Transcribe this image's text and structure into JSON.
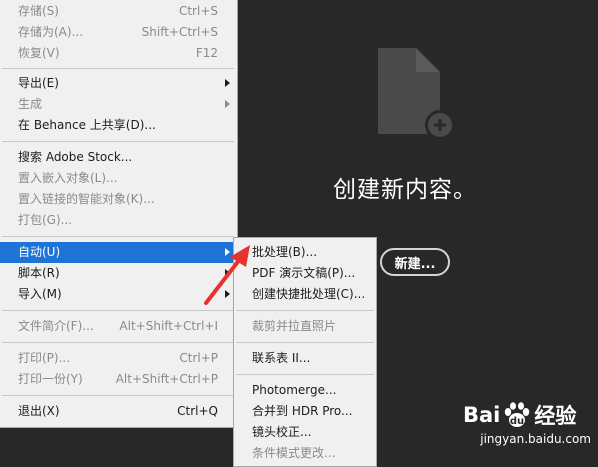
{
  "start_panel": {
    "title": "创建新内容。",
    "new_button": "新建..."
  },
  "file_menu": {
    "items": [
      {
        "label": "存储(S)",
        "shortcut": "Ctrl+S",
        "disabled": true
      },
      {
        "label": "存储为(A)...",
        "shortcut": "Shift+Ctrl+S",
        "disabled": true
      },
      {
        "label": "恢复(V)",
        "shortcut": "F12",
        "disabled": true
      },
      {
        "label": "导出(E)",
        "shortcut": "",
        "submenu": true
      },
      {
        "label": "生成",
        "shortcut": "",
        "submenu": true,
        "disabled": true
      },
      {
        "label": "在 Behance 上共享(D)...",
        "shortcut": ""
      },
      {
        "label": "搜索 Adobe Stock...",
        "shortcut": ""
      },
      {
        "label": "置入嵌入对象(L)...",
        "shortcut": "",
        "disabled": true
      },
      {
        "label": "置入链接的智能对象(K)...",
        "shortcut": "",
        "disabled": true
      },
      {
        "label": "打包(G)...",
        "shortcut": "",
        "disabled": true
      },
      {
        "label": "自动(U)",
        "shortcut": "",
        "submenu": true,
        "active": true
      },
      {
        "label": "脚本(R)",
        "shortcut": "",
        "submenu": true
      },
      {
        "label": "导入(M)",
        "shortcut": "",
        "submenu": true
      },
      {
        "label": "文件简介(F)...",
        "shortcut": "Alt+Shift+Ctrl+I",
        "disabled": true
      },
      {
        "label": "打印(P)...",
        "shortcut": "Ctrl+P",
        "disabled": true
      },
      {
        "label": "打印一份(Y)",
        "shortcut": "Alt+Shift+Ctrl+P",
        "disabled": true
      },
      {
        "label": "退出(X)",
        "shortcut": "Ctrl+Q"
      }
    ]
  },
  "automate_submenu": {
    "items": [
      {
        "label": "批处理(B)..."
      },
      {
        "label": "PDF 演示文稿(P)..."
      },
      {
        "label": "创建快捷批处理(C)..."
      },
      {
        "label": "裁剪并拉直照片",
        "disabled": true
      },
      {
        "label": "联系表 II..."
      },
      {
        "label": "Photomerge..."
      },
      {
        "label": "合并到 HDR Pro..."
      },
      {
        "label": "镜头校正..."
      },
      {
        "label": "条件模式更改...",
        "disabled": true
      }
    ]
  },
  "watermark": {
    "brand_left": "Bai",
    "brand_right": "经验",
    "url": "jingyan.baidu.com"
  },
  "colors": {
    "workspace_bg": "#282828",
    "menu_bg": "#f0f0f0",
    "highlight": "#1e73d6",
    "annotation_arrow": "#e8322e"
  }
}
